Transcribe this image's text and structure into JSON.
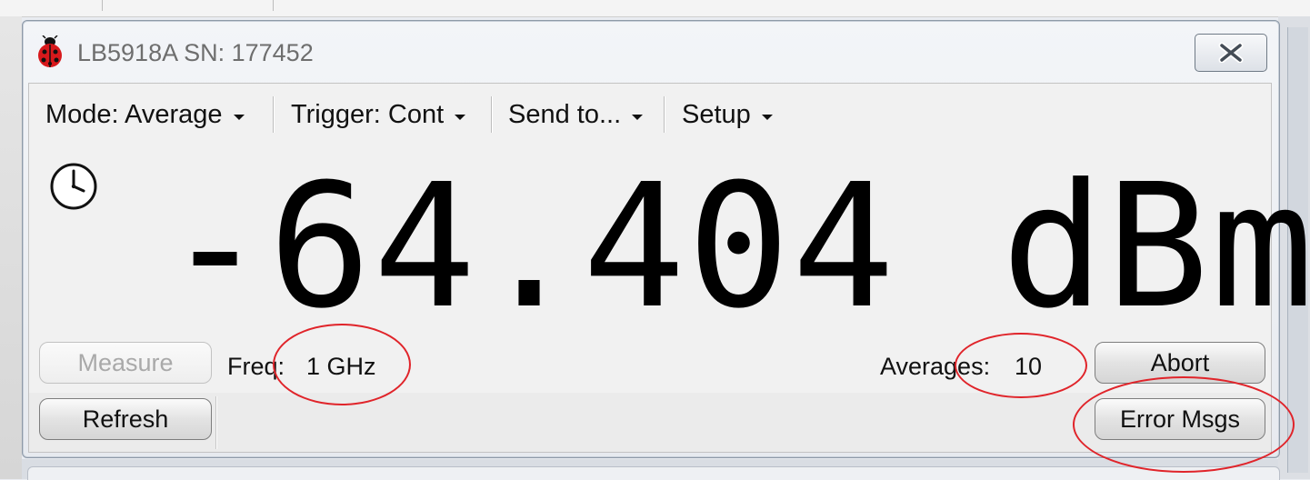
{
  "window": {
    "title": "LB5918A SN: 177452"
  },
  "toolbar": {
    "mode_label": "Mode: Average",
    "trigger_label": "Trigger: Cont",
    "send_label": "Send to...",
    "setup_label": "Setup"
  },
  "reading": {
    "value": "-64.404",
    "unit": "dBm"
  },
  "controls": {
    "measure_label": "Measure",
    "freq_label": "Freq:",
    "freq_value": "1 GHz",
    "averages_label": "Averages:",
    "averages_value": "10",
    "abort_label": "Abort",
    "refresh_label": "Refresh",
    "error_msgs_label": "Error Msgs"
  },
  "icons": {
    "app": "ladybug-icon",
    "close": "close-icon",
    "clock": "clock-icon",
    "menu_caret": "caret-down-icon"
  },
  "colors": {
    "annotation": "#e0242a",
    "title_text": "#6e6e6e",
    "disabled_text": "#a9a9a9"
  }
}
